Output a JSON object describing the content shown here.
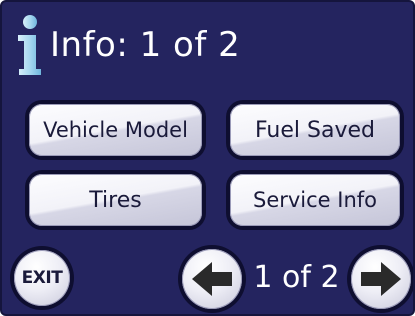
{
  "header": {
    "icon": "info-icon",
    "title": "Info: 1 of 2"
  },
  "menu": {
    "buttons": [
      {
        "label": "Vehicle Model"
      },
      {
        "label": "Fuel Saved"
      },
      {
        "label": "Tires"
      },
      {
        "label": "Service Info"
      }
    ]
  },
  "footer": {
    "exit_label": "EXIT",
    "prev_icon": "arrow-left-icon",
    "next_icon": "arrow-right-icon",
    "page_indicator": "1 of 2"
  },
  "colors": {
    "background": "#24245f",
    "text": "#ffffff",
    "info_icon": "#a8d8f0",
    "button_text": "#1a1a3a",
    "arrow": "#2a2a2a"
  }
}
